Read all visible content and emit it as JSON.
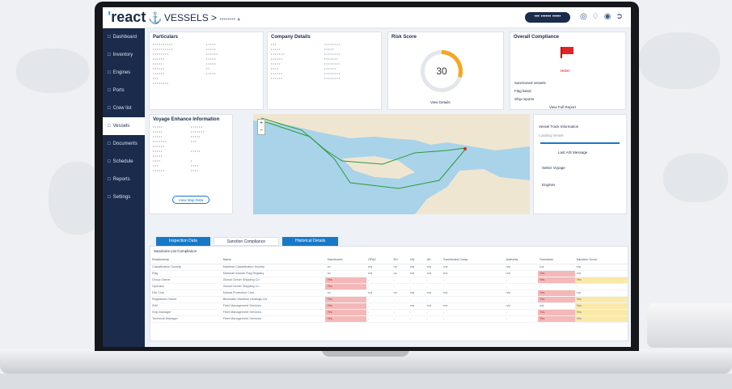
{
  "app": {
    "logo": "react",
    "crumb": "VESSELS >",
    "crumb_sub": "•••••••• ●",
    "top_button": "••• •••••• •••••"
  },
  "sidebar": {
    "items": [
      {
        "label": "Dashboard",
        "icon": "dashboard-icon"
      },
      {
        "label": "Inventory",
        "icon": "inventory-icon"
      },
      {
        "label": "Engines",
        "icon": "engines-icon"
      },
      {
        "label": "Ports",
        "icon": "ports-icon"
      },
      {
        "label": "Crew list",
        "icon": "crew-icon"
      },
      {
        "label": "Vessels",
        "icon": "vessel-icon"
      },
      {
        "label": "Documents",
        "icon": "documents-icon"
      },
      {
        "label": "Schedule",
        "icon": "schedule-icon"
      },
      {
        "label": "Reports",
        "icon": "reports-icon"
      },
      {
        "label": "Settings",
        "icon": "settings-icon"
      }
    ]
  },
  "cards": {
    "particulars": {
      "title": "Particulars"
    },
    "company": {
      "title": "Company Details"
    },
    "risk": {
      "title": "Risk Score",
      "score": "30",
      "link": "View Details"
    },
    "overall": {
      "title": "Overall Compliance",
      "status": "HIGH",
      "lines": [
        "Sanctioned vessels",
        "Flag listed",
        "Ship reports"
      ],
      "link": "View Full Report"
    },
    "voyage": {
      "title": "Voyage Enhance Information",
      "button": "View Map Data"
    }
  },
  "right_panel": {
    "title": "Vessel Track Information",
    "sub": "Loading Vessel",
    "note": "Last AIS Message",
    "opt1": "Select Voyage",
    "opt2": "Engines"
  },
  "tabs": [
    "Inspection Data",
    "Sanction Compliance",
    "Historical Details"
  ],
  "table": {
    "caption": "Sanctions List Compliance",
    "headers": [
      "Relationship",
      "Name",
      "Sanctioned",
      "OFAC",
      "EU",
      "UN",
      "UK",
      "Sanctioned Comp.",
      "Authority",
      "Sanctions",
      "Sanction Score"
    ],
    "rows": [
      [
        "Classification Society",
        "Maritime Classification Society",
        "no",
        "n/a",
        "no",
        "n/a",
        "n/a",
        "n/a",
        "n/a",
        "n/a",
        "n/a"
      ],
      [
        "Flag",
        "Marshall Islands Flag Registry",
        "no",
        "n/a",
        "no",
        "n/a",
        "n/a",
        "n/a",
        "n/a",
        "Yes",
        "n/a"
      ],
      [
        "Group Owner",
        "Global Ocean Shipping Co",
        "Yes",
        "-",
        "-",
        "-",
        "-",
        "-",
        "-",
        "Yes",
        "Yes"
      ],
      [
        "Operator",
        "Global Ocean Shipping Co",
        "Yes",
        "-",
        "-",
        "-",
        "-",
        "-",
        "-",
        "-",
        "-"
      ],
      [
        "P&I Club",
        "Mutual Protection Club",
        "no",
        "n/a",
        "no",
        "n/a",
        "n/a",
        "n/a",
        "n/a",
        "Yes",
        "n/a"
      ],
      [
        "Registered Owner",
        "Bluewater Maritime Holdings Ltd",
        "Yes",
        "-",
        "-",
        "-",
        "-",
        "-",
        "-",
        "Yes",
        "Yes"
      ],
      [
        "ISM",
        "Fleet Management Services",
        "Yes",
        "-",
        "-",
        "n/a",
        "n/a",
        "n/a",
        "n/a",
        "n/a",
        "Yes"
      ],
      [
        "Ship Manager",
        "Fleet Management Services",
        "Yes",
        "-",
        "-",
        "-",
        "-",
        "-",
        "-",
        "Yes",
        "Yes"
      ],
      [
        "Technical Manager",
        "Fleet Management Services",
        "Yes",
        "-",
        "-",
        "-",
        "-",
        "-",
        "-",
        "Yes",
        "Yes"
      ]
    ]
  }
}
